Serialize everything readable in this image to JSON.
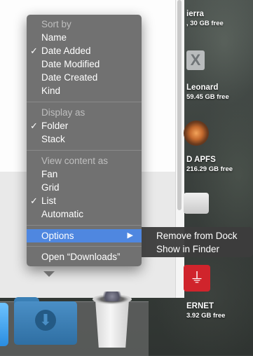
{
  "desktop": {
    "volumes": [
      {
        "name": "ierra",
        "free": ", 30 GB free"
      },
      {
        "name": "Leonard",
        "free": "59.45 GB free"
      },
      {
        "name": "D APFS",
        "free": "216.29 GB free"
      },
      {
        "name": "ERNET",
        "free": "3.92 GB free"
      }
    ],
    "volume_icon_x": "X"
  },
  "menu": {
    "sort_by": {
      "header": "Sort by",
      "items": [
        {
          "label": "Name",
          "checked": false
        },
        {
          "label": "Date Added",
          "checked": true
        },
        {
          "label": "Date Modified",
          "checked": false
        },
        {
          "label": "Date Created",
          "checked": false
        },
        {
          "label": "Kind",
          "checked": false
        }
      ]
    },
    "display_as": {
      "header": "Display as",
      "items": [
        {
          "label": "Folder",
          "checked": true
        },
        {
          "label": "Stack",
          "checked": false
        }
      ]
    },
    "view_content_as": {
      "header": "View content as",
      "items": [
        {
          "label": "Fan",
          "checked": false
        },
        {
          "label": "Grid",
          "checked": false
        },
        {
          "label": "List",
          "checked": true
        },
        {
          "label": "Automatic",
          "checked": false
        }
      ]
    },
    "options_label": "Options",
    "open_label": "Open “Downloads”",
    "check_glyph": "✓",
    "submenu_arrow": "▶"
  },
  "submenu": {
    "remove_from_dock": "Remove from Dock",
    "show_in_finder": "Show in Finder"
  },
  "dock": {
    "folder_icon": "downloads-folder-icon",
    "trash_icon": "trash-icon",
    "download_glyph": "⬇"
  },
  "colors": {
    "menu_background": "#6c6c6c",
    "highlight": "#4f87e0",
    "header_text": "#bfbfbf"
  }
}
